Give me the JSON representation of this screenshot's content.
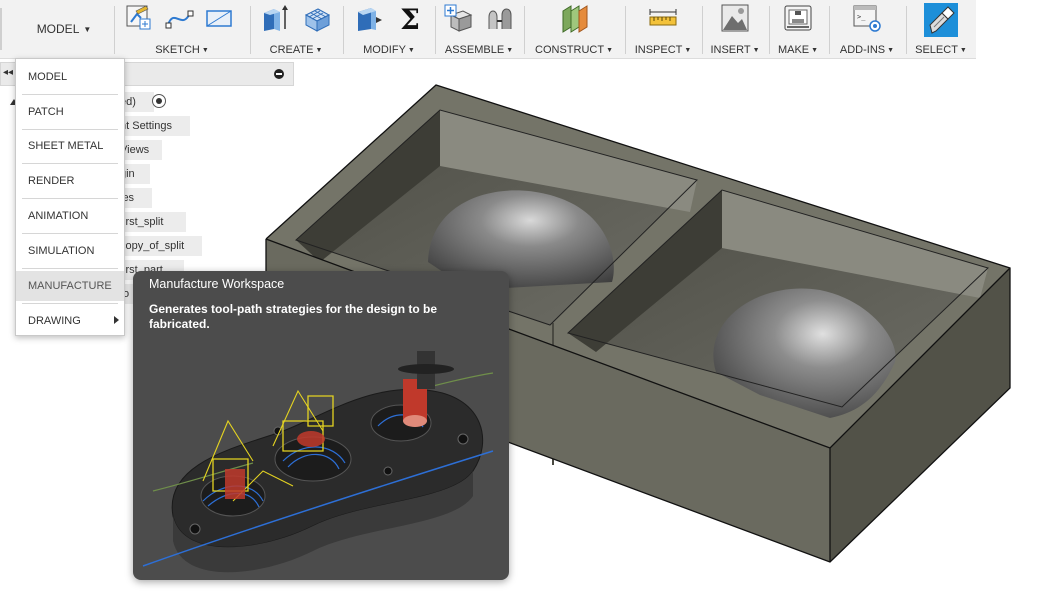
{
  "toolbar": {
    "workspace": "MODEL",
    "groups": [
      {
        "label": "SKETCH"
      },
      {
        "label": "CREATE"
      },
      {
        "label": "MODIFY"
      },
      {
        "label": "ASSEMBLE"
      },
      {
        "label": "CONSTRUCT"
      },
      {
        "label": "INSPECT"
      },
      {
        "label": "INSERT"
      },
      {
        "label": "MAKE"
      },
      {
        "label": "ADD-INS"
      },
      {
        "label": "SELECT"
      }
    ],
    "icons": [
      "create-sketch-icon",
      "spline-icon",
      "rectangle-sketch-icon",
      "extrude-icon",
      "form-icon",
      "press-pull-icon",
      "sigma-icon",
      "new-component-icon",
      "joint-icon",
      "offset-plane-icon",
      "measure-icon",
      "insert-image-icon",
      "3d-print-icon",
      "scripts-icon",
      "select-icon"
    ]
  },
  "workspace_menu": {
    "items": [
      {
        "label": "MODEL"
      },
      {
        "label": "PATCH"
      },
      {
        "label": "SHEET METAL"
      },
      {
        "label": "RENDER"
      },
      {
        "label": "ANIMATION"
      },
      {
        "label": "SIMULATION"
      },
      {
        "label": "MANUFACTURE",
        "highlighted": true
      },
      {
        "label": "DRAWING",
        "has_submenu": true
      }
    ]
  },
  "browser": {
    "collapse": "◂◂",
    "items": [
      {
        "label": "ed)"
      },
      {
        "label": "nt Settings"
      },
      {
        "label": "Views"
      },
      {
        "label": "gin"
      },
      {
        "label": "ies"
      },
      {
        "label": "first_split"
      },
      {
        "label": "copy_of_split"
      },
      {
        "label": "first_part"
      },
      {
        "label": "to"
      }
    ]
  },
  "tooltip": {
    "title": "Manufacture Workspace",
    "description": "Generates tool-path strategies for the design to be fabricated."
  },
  "colors": {
    "toolbar_bg": "#f2f2f2",
    "menu_highlight": "#e3e3e3",
    "tooltip_bg": "#4c4c4c",
    "select_accent": "#1d8fd9",
    "model_body": "#56564b"
  }
}
